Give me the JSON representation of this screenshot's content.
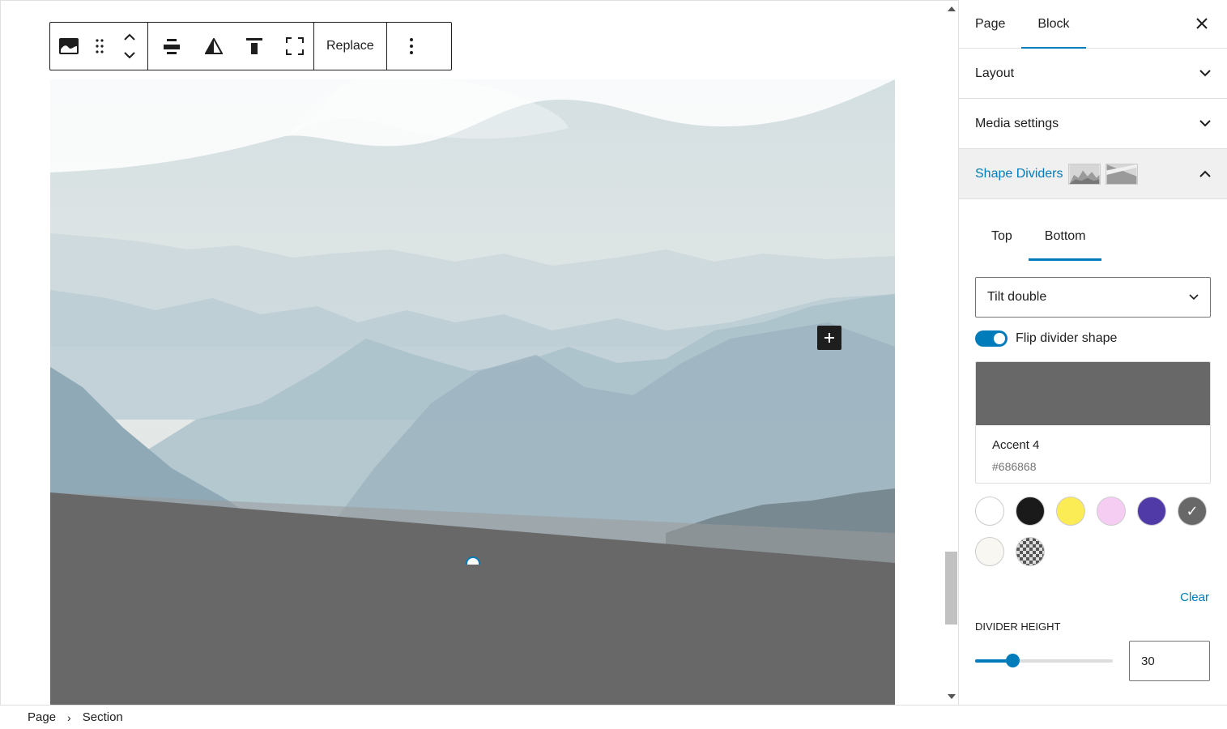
{
  "toolbar": {
    "replace_label": "Replace",
    "icons": [
      "cover-block-icon",
      "drag-handle-icon",
      "move-up-down-icon",
      "align-icon",
      "contrast-icon",
      "vertical-align-top-icon",
      "full-height-icon",
      "more-options-icon"
    ]
  },
  "sidebar": {
    "tabs": [
      {
        "label": "Page"
      },
      {
        "label": "Block"
      }
    ],
    "active_tab": "Block",
    "panels": {
      "layout": "Layout",
      "media_settings": "Media settings",
      "shape_dividers": "Shape Dividers"
    },
    "shape_dividers": {
      "position_tabs": [
        {
          "label": "Top"
        },
        {
          "label": "Bottom"
        }
      ],
      "active_position": "Bottom",
      "style_value": "Tilt double",
      "flip_label": "Flip divider shape",
      "flip_enabled": true,
      "selected_color": {
        "name": "Accent 4",
        "hex": "#686868"
      },
      "swatches": [
        {
          "name": "white",
          "hex": "#ffffff"
        },
        {
          "name": "black",
          "hex": "#1a1a1a"
        },
        {
          "name": "yellow",
          "hex": "#fbeb54"
        },
        {
          "name": "pink",
          "hex": "#f5cdf2"
        },
        {
          "name": "purple",
          "hex": "#503aa8"
        },
        {
          "name": "accent-4",
          "hex": "#686868",
          "selected": true
        },
        {
          "name": "off-white",
          "hex": "#f8f7f1"
        },
        {
          "name": "transparent",
          "hex": "transparent"
        }
      ],
      "clear_label": "Clear",
      "height_label": "DIVIDER HEIGHT",
      "height_value": "30",
      "height_fraction": 0.27
    }
  },
  "breadcrumb": {
    "items": [
      "Page",
      "Section"
    ]
  },
  "colors": {
    "accent": "#007cba",
    "divider": "#686868"
  }
}
